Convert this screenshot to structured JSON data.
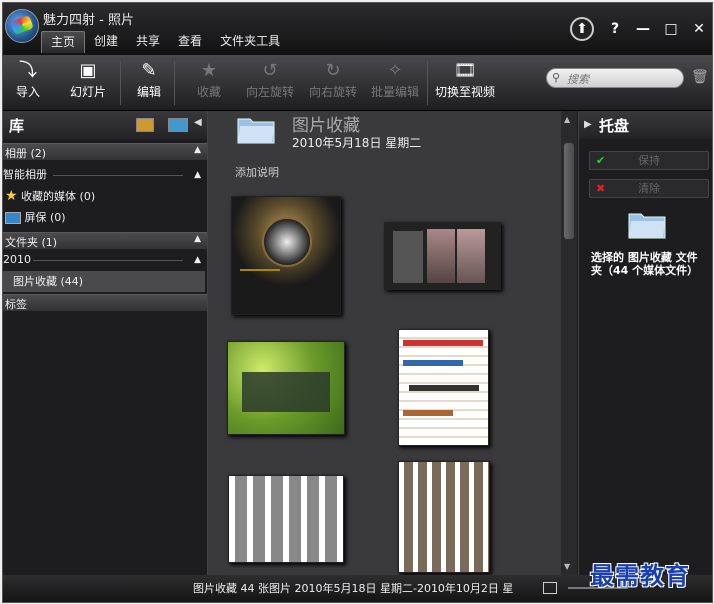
{
  "window": {
    "title": "魅力四射 - 照片"
  },
  "menu_tabs": [
    {
      "label": "主页",
      "active": true
    },
    {
      "label": "创建",
      "active": false
    },
    {
      "label": "共享",
      "active": false
    },
    {
      "label": "查看",
      "active": false
    },
    {
      "label": "文件夹工具",
      "active": false
    }
  ],
  "window_buttons": {
    "help": "?",
    "minimize": "—",
    "maximize": "□",
    "close": "✕"
  },
  "toolbar": {
    "import": "导入",
    "slideshow": "幻灯片",
    "edit": "编辑",
    "favorite": "收藏",
    "rotate_left": "向左旋转",
    "rotate_right": "向右旋转",
    "batch_edit": "批量编辑",
    "switch_to_video": "切换至视频"
  },
  "search": {
    "placeholder": "搜索"
  },
  "library": {
    "title": "库",
    "albums": "相册 (2)",
    "smart_albums": "智能相册",
    "favorites": "收藏的媒体 (0)",
    "screensaver": "屏保 (0)",
    "folders": "文件夹 (1)",
    "year": "2010",
    "folder_item": "图片收藏 (44)",
    "tags": "标签"
  },
  "folder": {
    "title": "图片收藏",
    "date": "2010年5月18日 星期二",
    "description": "添加说明"
  },
  "tray": {
    "title": "托盘",
    "keep": "保持",
    "clear": "清除",
    "info": "选择的 图片收藏 文件夹（44 个媒体文件）"
  },
  "status": {
    "text": "图片收藏  44 张图片  2010年5月18日 星期二-2010年10月2日 星"
  },
  "watermark": "最需教育",
  "colors": {
    "accent_check": "#3c3",
    "accent_clear": "#d22",
    "folder_blue": "#8ab4e0"
  }
}
